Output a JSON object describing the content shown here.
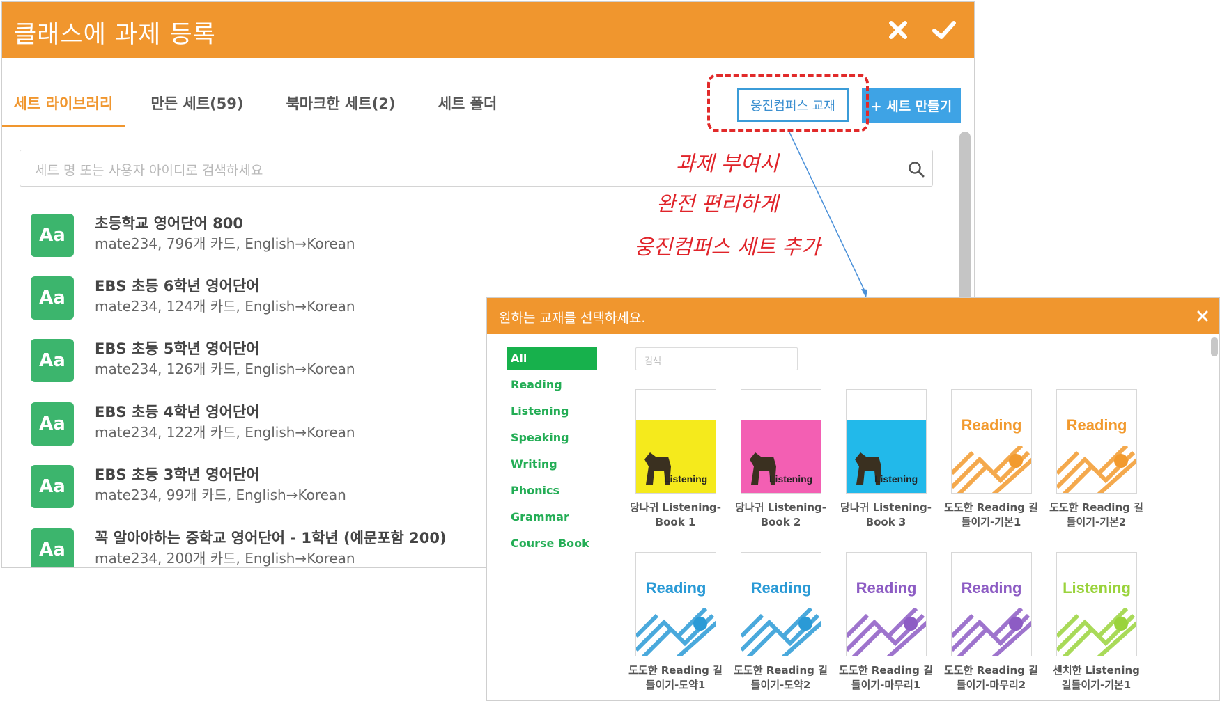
{
  "main": {
    "title": "클래스에 과제 등록",
    "tabs": [
      {
        "label": "세트 라이브러리"
      },
      {
        "label": "만든 세트(59)"
      },
      {
        "label": "북마크한 세트(2)"
      },
      {
        "label": "세트 폴더"
      }
    ],
    "wj_button": "웅진컴퍼스 교재",
    "make_button": "+ 세트 만들기",
    "search_placeholder": "세트 명 또는 사용자 아이디로 검색하세요",
    "sets": [
      {
        "badge": "Aa",
        "title": "초등학교 영어단어 800",
        "meta": "mate234, 796개 카드, English→Korean"
      },
      {
        "badge": "Aa",
        "title": "EBS 초등 6학년 영어단어",
        "meta": "mate234, 124개 카드, English→Korean"
      },
      {
        "badge": "Aa",
        "title": "EBS 초등 5학년 영어단어",
        "meta": "mate234, 126개 카드, English→Korean"
      },
      {
        "badge": "Aa",
        "title": "EBS 초등 4학년 영어단어",
        "meta": "mate234, 122개 카드, English→Korean"
      },
      {
        "badge": "Aa",
        "title": "EBS 초등 3학년 영어단어",
        "meta": "mate234, 99개 카드, English→Korean"
      },
      {
        "badge": "Aa",
        "title": "꼭 알아야하는 중학교 영어단어 - 1학년 (예문포함 200)",
        "meta": "mate234, 200개 카드, English→Korean"
      }
    ]
  },
  "annotation": {
    "lines": [
      "과제 부여시",
      "완전 편리하게",
      "웅진컴퍼스 세트 추가"
    ]
  },
  "dialog": {
    "title": "원하는 교재를 선택하세요.",
    "search_placeholder": "검색",
    "categories": [
      "All",
      "Reading",
      "Listening",
      "Speaking",
      "Writing",
      "Phonics",
      "Grammar",
      "Course Book"
    ],
    "books": [
      {
        "title1": "당나귀 Listening-",
        "title2": "Book 1",
        "cover_color": "#f5ea1c",
        "cover_text": "Listening"
      },
      {
        "title1": "당나귀 Listening-",
        "title2": "Book 2",
        "cover_color": "#f35fb3",
        "cover_text": "Listening"
      },
      {
        "title1": "당나귀 Listening-",
        "title2": "Book 3",
        "cover_color": "#22b9ea",
        "cover_text": "Listening"
      },
      {
        "title1": "도도한 Reading 길",
        "title2": "들이기-기본1",
        "cover_color": "#f29a2e",
        "cover_text": "Reading"
      },
      {
        "title1": "도도한 Reading 길",
        "title2": "들이기-기본2",
        "cover_color": "#f29a2e",
        "cover_text": "Reading"
      },
      {
        "title1": "도도한 Reading 길",
        "title2": "들이기-도약1",
        "cover_color": "#2a9ad6",
        "cover_text": "Reading"
      },
      {
        "title1": "도도한 Reading 길",
        "title2": "들이기-도약2",
        "cover_color": "#2a9ad6",
        "cover_text": "Reading"
      },
      {
        "title1": "도도한 Reading 길",
        "title2": "들이기-마무리1",
        "cover_color": "#8d5cc4",
        "cover_text": "Reading"
      },
      {
        "title1": "도도한 Reading 길",
        "title2": "들이기-마무리2",
        "cover_color": "#8d5cc4",
        "cover_text": "Reading"
      },
      {
        "title1": "센치한 Listening",
        "title2": "길들이기-기본1",
        "cover_color": "#9ad33c",
        "cover_text": "Listening"
      }
    ]
  },
  "colors": {
    "header_orange": "#f0962e",
    "badge_green": "#3cb56d",
    "category_green": "#23ad55",
    "primary_blue": "#3ea3e5",
    "annotation_red": "#e0242a"
  }
}
